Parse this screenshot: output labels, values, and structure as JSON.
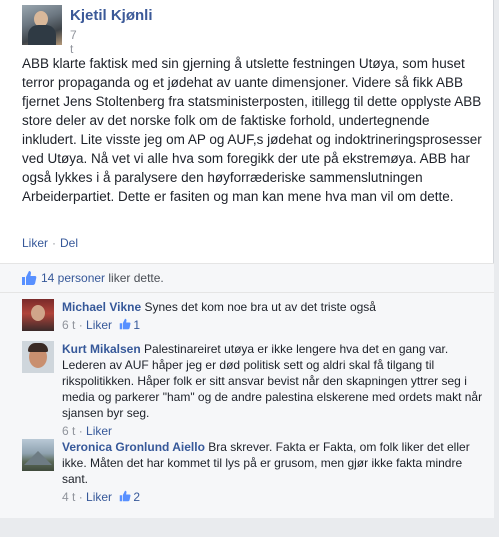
{
  "post": {
    "author": "Kjetil Kjønli",
    "timestamp": "7 t",
    "text": "ABB klarte faktisk med sin gjerning å utslette festningen Utøya, som huset terror propaganda og et jødehat av uante dimensjoner. Videre så fikk ABB fjernet Jens Stoltenberg fra statsministerposten, itillegg til dette opplyste ABB store deler av det norske folk om de faktiske forhold, undertegnende inkludert. Lite visste jeg om AP og AUF,s jødehat og indoktrineringsprosesser ved Utøya. Nå vet vi alle hva som foregikk der ute på ekstremøya. ABB har også lykkes i å paralysere den høyforræderiske sammenslutningen Arbeiderpartiet. Dette er fasiten og man kan mene hva man vil om dette.",
    "actions": {
      "like": "Liker",
      "separator": "·",
      "share": "Del"
    }
  },
  "likes_summary": {
    "count_label": "14 personer",
    "suffix": " liker dette."
  },
  "comments": [
    {
      "author": "Michael Vikne",
      "text": "Synes det kom noe bra ut av det triste også",
      "time": "6 t",
      "like_label": "Liker",
      "likes": "1"
    },
    {
      "author": "Kurt Mikalsen",
      "text": "Palestinareiret utøya er ikke lengere hva det en gang var. Lederen av AUF håper jeg er død politisk sett og aldri skal få tilgang til rikspolitikken. Håper folk er sitt ansvar bevist når den skapningen yttrer seg i media og parkerer \"ham\" og de andre palestina elskerene med ordets makt når sjansen byr seg.",
      "time": "6 t",
      "like_label": "Liker",
      "likes": ""
    },
    {
      "author": "Veronica Gronlund Aiello",
      "text": "Bra skrever. Fakta er Fakta, om folk liker det eller ikke. Måten det har kommet til lys på er grusom, men gjør ikke fakta mindre sant.",
      "time": "4 t",
      "like_label": "Liker",
      "likes": "2"
    }
  ],
  "meta_separator": "·",
  "colors": {
    "link": "#365899",
    "author": "#3b5998",
    "muted": "#90949c",
    "bg": "#e9ebee"
  }
}
